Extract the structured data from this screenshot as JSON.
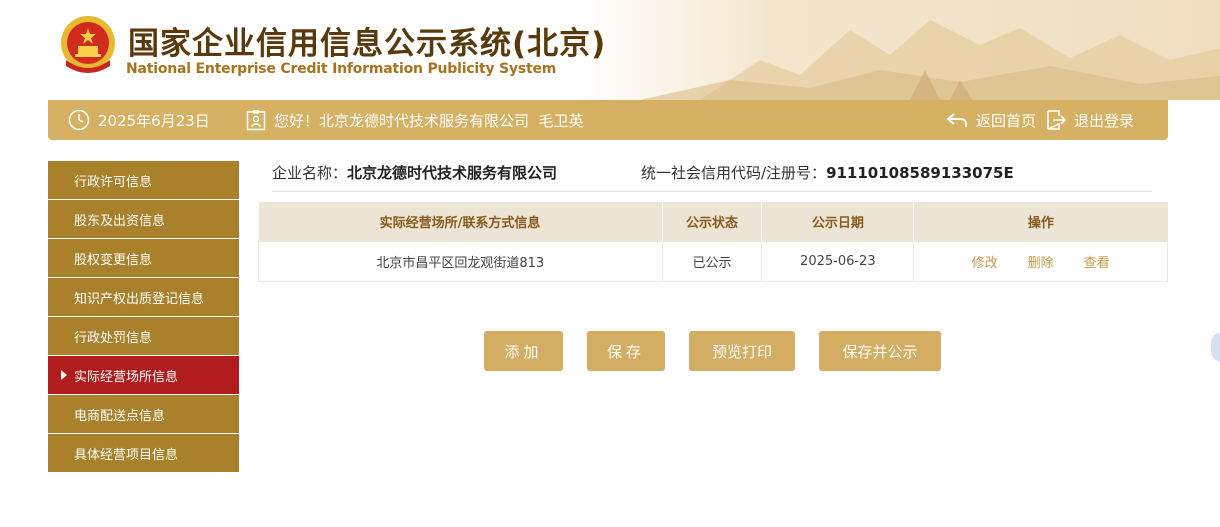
{
  "header": {
    "title_cn": "国家企业信用信息公示系统(北京)",
    "title_en": "National Enterprise Credit Information Publicity System"
  },
  "infobar": {
    "date": "2025年6月23日",
    "greeting": "您好！北京龙德时代技术服务有限公司  毛卫英",
    "home_label": "返回首页",
    "logout_label": "退出登录"
  },
  "sidebar": {
    "items": [
      {
        "label": "行政许可信息"
      },
      {
        "label": "股东及出资信息"
      },
      {
        "label": "股权变更信息"
      },
      {
        "label": "知识产权出质登记信息"
      },
      {
        "label": "行政处罚信息"
      },
      {
        "label": "实际经营场所信息",
        "active": true
      },
      {
        "label": "电商配送点信息"
      },
      {
        "label": "具体经营项目信息"
      }
    ]
  },
  "company": {
    "name_label": "企业名称：",
    "name_value": "北京龙德时代技术服务有限公司",
    "code_label": "统一社会信用代码/注册号：",
    "code_value": "91110108589133075E"
  },
  "table": {
    "headers": [
      "实际经营场所/联系方式信息",
      "公示状态",
      "公示日期",
      "操作"
    ],
    "rows": [
      {
        "address": "北京市昌平区回龙观街道813",
        "status": "已公示",
        "date": "2025-06-23"
      }
    ],
    "actions": {
      "edit": "修改",
      "delete": "删除",
      "view": "查看"
    }
  },
  "buttons": {
    "add": "添加",
    "save": "保存",
    "preview": "预览打印",
    "save_publish": "保存并公示"
  },
  "colors": {
    "brand_gold": "#d6b063",
    "sidebar_gold": "#a9812b",
    "active_red": "#b11c1c",
    "title_brown": "#5a3a0c"
  }
}
